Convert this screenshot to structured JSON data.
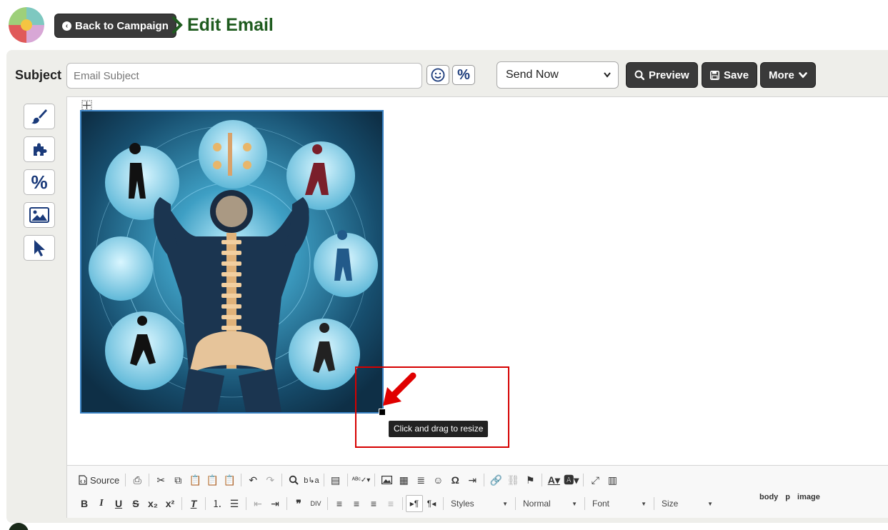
{
  "header": {
    "back_label": "Back to Campaign",
    "title": "Edit Email",
    "back_icon": "chevron-left-circle-icon",
    "logo_icon": "puzzle-logo-icon"
  },
  "subject": {
    "label": "Subject",
    "placeholder": "Email Subject",
    "value": "",
    "emoji_icon": "smiley-icon",
    "merge_icon": "percent-icon"
  },
  "send": {
    "selected": "Send Now"
  },
  "actions": {
    "preview": "Preview",
    "save": "Save",
    "more": "More"
  },
  "side_tools": [
    {
      "icon": "paintbrush-icon"
    },
    {
      "icon": "puzzle-piece-icon"
    },
    {
      "icon": "percent-icon"
    },
    {
      "icon": "image-icon"
    },
    {
      "icon": "cursor-icon"
    }
  ],
  "editor": {
    "image_alt": "Spine health illustration",
    "resize_tooltip": "Click and drag to resize"
  },
  "toolbar": {
    "source_label": "Source",
    "styles_label": "Styles",
    "format_label": "Normal",
    "font_label": "Font",
    "size_label": "Size",
    "path": [
      "body",
      "p",
      "image"
    ]
  },
  "colors": {
    "title_green": "#1e5b1e",
    "button_dark": "#3a3a3a",
    "icon_navy": "#1a3a7a",
    "highlight_red": "#d60000"
  }
}
